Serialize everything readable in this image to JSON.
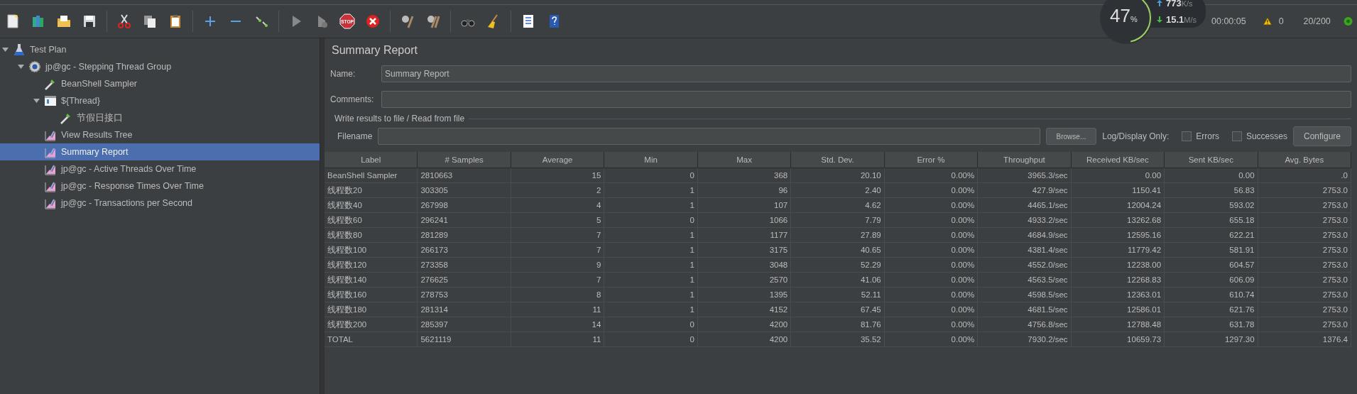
{
  "toolbar": {
    "stop_label": "STOP"
  },
  "monitor": {
    "cpu": "47",
    "cpu_unit": "%",
    "upload": "773",
    "upload_unit": "K/s",
    "download": "15.1",
    "download_unit": "M/s",
    "level": 0.47
  },
  "status": {
    "elapsed": "00:00:05",
    "warnings": "0",
    "threads": "20/200"
  },
  "tree": [
    {
      "label": "Test Plan",
      "kind": "plan",
      "expanded": true,
      "selected": false,
      "children": [
        {
          "label": "jp@gc - Stepping Thread Group",
          "kind": "group",
          "expanded": true,
          "selected": false,
          "children": [
            {
              "label": "BeanShell Sampler",
              "kind": "sampler",
              "selected": false
            },
            {
              "label": "${Thread}",
              "kind": "controller",
              "expanded": true,
              "selected": false,
              "children": [
                {
                  "label": "节假日接口",
                  "kind": "sampler",
                  "selected": false
                }
              ]
            },
            {
              "label": "View Results Tree",
              "kind": "listener",
              "selected": false
            },
            {
              "label": "Summary Report",
              "kind": "listener",
              "selected": true
            },
            {
              "label": "jp@gc - Active Threads Over Time",
              "kind": "listener",
              "selected": false
            },
            {
              "label": "jp@gc - Response Times Over Time",
              "kind": "listener",
              "selected": false
            },
            {
              "label": "jp@gc - Transactions per Second",
              "kind": "listener",
              "selected": false
            }
          ]
        }
      ]
    }
  ],
  "panel": {
    "title": "Summary Report",
    "name_label": "Name:",
    "name_value": "Summary Report",
    "comments_label": "Comments:",
    "file_legend": "Write results to file / Read from file",
    "filename_label": "Filename",
    "browse_button": "Browse...",
    "log_label": "Log/Display Only:",
    "checks": [
      {
        "label": "Errors",
        "checked": false
      },
      {
        "label": "Successes",
        "checked": false
      }
    ],
    "configure_button": "Configure"
  },
  "table": {
    "columns": [
      "Label",
      "# Samples",
      "Average",
      "Min",
      "Max",
      "Std. Dev.",
      "Error %",
      "Throughput",
      "Received KB/sec",
      "Sent KB/sec",
      "Avg. Bytes"
    ],
    "rows": [
      [
        "BeanShell Sampler",
        "2810663",
        "15",
        "0",
        "368",
        "20.10",
        "0.00%",
        "3965.3/sec",
        "0.00",
        "0.00",
        ".0"
      ],
      [
        "线程数20",
        "303305",
        "2",
        "1",
        "96",
        "2.40",
        "0.00%",
        "427.9/sec",
        "1150.41",
        "56.83",
        "2753.0"
      ],
      [
        "线程数40",
        "267998",
        "4",
        "1",
        "107",
        "4.62",
        "0.00%",
        "4465.1/sec",
        "12004.24",
        "593.02",
        "2753.0"
      ],
      [
        "线程数60",
        "296241",
        "5",
        "0",
        "1066",
        "7.79",
        "0.00%",
        "4933.2/sec",
        "13262.68",
        "655.18",
        "2753.0"
      ],
      [
        "线程数80",
        "281289",
        "7",
        "1",
        "1177",
        "27.89",
        "0.00%",
        "4684.9/sec",
        "12595.16",
        "622.21",
        "2753.0"
      ],
      [
        "线程数100",
        "266173",
        "7",
        "1",
        "3175",
        "40.65",
        "0.00%",
        "4381.4/sec",
        "11779.42",
        "581.91",
        "2753.0"
      ],
      [
        "线程数120",
        "273358",
        "9",
        "1",
        "3048",
        "52.29",
        "0.00%",
        "4552.0/sec",
        "12238.00",
        "604.57",
        "2753.0"
      ],
      [
        "线程数140",
        "276625",
        "7",
        "1",
        "2570",
        "41.06",
        "0.00%",
        "4563.5/sec",
        "12268.83",
        "606.09",
        "2753.0"
      ],
      [
        "线程数160",
        "278753",
        "8",
        "1",
        "1395",
        "52.11",
        "0.00%",
        "4598.5/sec",
        "12363.01",
        "610.74",
        "2753.0"
      ],
      [
        "线程数180",
        "281314",
        "11",
        "1",
        "4152",
        "67.45",
        "0.00%",
        "4681.5/sec",
        "12586.01",
        "621.76",
        "2753.0"
      ],
      [
        "线程数200",
        "285397",
        "14",
        "0",
        "4200",
        "81.76",
        "0.00%",
        "4756.8/sec",
        "12788.48",
        "631.78",
        "2753.0"
      ],
      [
        "TOTAL",
        "5621119",
        "11",
        "0",
        "4200",
        "35.52",
        "0.00%",
        "7930.2/sec",
        "10659.73",
        "1297.30",
        "1376.4"
      ]
    ]
  }
}
